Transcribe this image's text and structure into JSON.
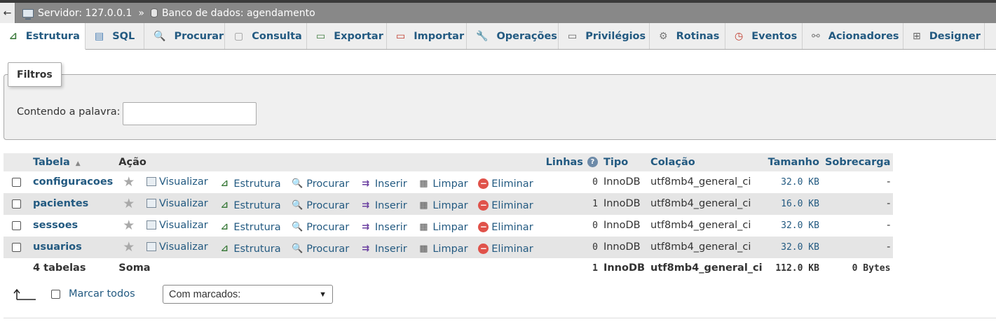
{
  "breadcrumb": {
    "back_label": "←",
    "server": "Servidor: 127.0.0.1",
    "separator": "»",
    "database": "Banco de dados: agendamento"
  },
  "tabs": [
    {
      "label": "Estrutura",
      "icon": "structure-icon"
    },
    {
      "label": "SQL",
      "icon": "sql-icon"
    },
    {
      "label": "Procurar",
      "icon": "search-icon"
    },
    {
      "label": "Consulta",
      "icon": "query-icon"
    },
    {
      "label": "Exportar",
      "icon": "export-icon"
    },
    {
      "label": "Importar",
      "icon": "import-icon"
    },
    {
      "label": "Operações",
      "icon": "wrench-icon"
    },
    {
      "label": "Privilégios",
      "icon": "privileges-icon"
    },
    {
      "label": "Rotinas",
      "icon": "routines-icon"
    },
    {
      "label": "Eventos",
      "icon": "clock-icon"
    },
    {
      "label": "Acionadores",
      "icon": "triggers-icon"
    },
    {
      "label": "Designer",
      "icon": "designer-icon"
    }
  ],
  "filters": {
    "legend": "Filtros",
    "label": "Contendo a palavra:",
    "value": ""
  },
  "table": {
    "headers": {
      "tabela": "Tabela",
      "acao": "Ação",
      "linhas": "Linhas",
      "tipo": "Tipo",
      "colacao": "Colação",
      "tamanho": "Tamanho",
      "sobrecarga": "Sobrecarga"
    },
    "actions": {
      "view": "Visualizar",
      "structure": "Estrutura",
      "search": "Procurar",
      "insert": "Inserir",
      "empty": "Limpar",
      "drop": "Eliminar"
    },
    "rows": [
      {
        "name": "configuracoes",
        "rows": "0",
        "type": "InnoDB",
        "collation": "utf8mb4_general_ci",
        "size": "32.0 KB",
        "overhead": "-"
      },
      {
        "name": "pacientes",
        "rows": "1",
        "type": "InnoDB",
        "collation": "utf8mb4_general_ci",
        "size": "16.0 KB",
        "overhead": "-"
      },
      {
        "name": "sessoes",
        "rows": "0",
        "type": "InnoDB",
        "collation": "utf8mb4_general_ci",
        "size": "32.0 KB",
        "overhead": "-"
      },
      {
        "name": "usuarios",
        "rows": "0",
        "type": "InnoDB",
        "collation": "utf8mb4_general_ci",
        "size": "32.0 KB",
        "overhead": "-"
      }
    ],
    "footer": {
      "count": "4 tabelas",
      "sum_label": "Soma",
      "rows": "1",
      "type": "InnoDB",
      "collation": "utf8mb4_general_ci",
      "size": "112.0 KB",
      "overhead": "0 Bytes"
    }
  },
  "bulk": {
    "mark_all": "Marcar todos",
    "with_selected": "Com marcados:"
  }
}
